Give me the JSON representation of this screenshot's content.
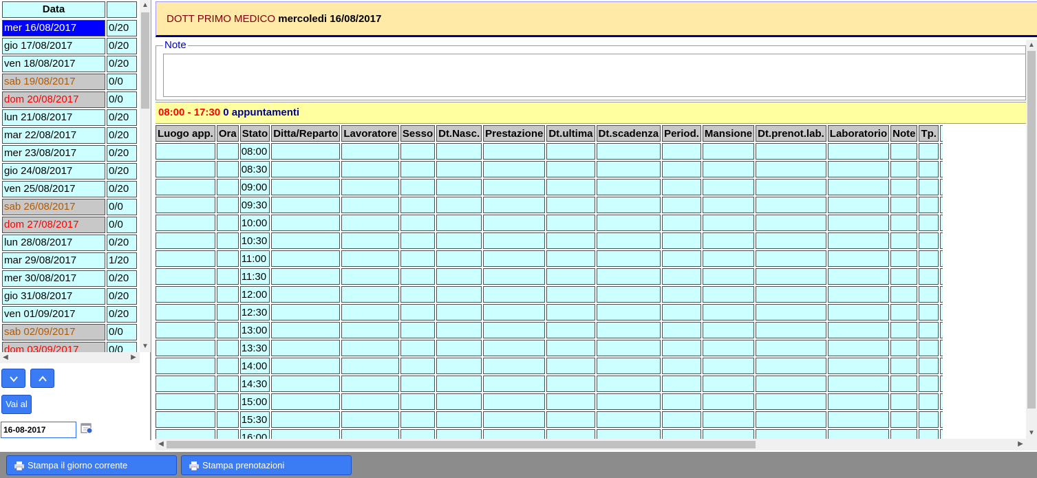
{
  "date_list": {
    "header_date": "Data",
    "header_count": "",
    "rows": [
      {
        "date": "mer 16/08/2017",
        "count": "0/20",
        "kind": "sel"
      },
      {
        "date": "gio 17/08/2017",
        "count": "0/20",
        "kind": "normal"
      },
      {
        "date": "ven 18/08/2017",
        "count": "0/20",
        "kind": "normal"
      },
      {
        "date": "sab 19/08/2017",
        "count": "0/0",
        "kind": "sat"
      },
      {
        "date": "dom 20/08/2017",
        "count": "0/0",
        "kind": "sun"
      },
      {
        "date": "lun 21/08/2017",
        "count": "0/20",
        "kind": "normal"
      },
      {
        "date": "mar 22/08/2017",
        "count": "0/20",
        "kind": "normal"
      },
      {
        "date": "mer 23/08/2017",
        "count": "0/20",
        "kind": "normal"
      },
      {
        "date": "gio 24/08/2017",
        "count": "0/20",
        "kind": "normal"
      },
      {
        "date": "ven 25/08/2017",
        "count": "0/20",
        "kind": "normal"
      },
      {
        "date": "sab 26/08/2017",
        "count": "0/0",
        "kind": "sat"
      },
      {
        "date": "dom 27/08/2017",
        "count": "0/0",
        "kind": "sun"
      },
      {
        "date": "lun 28/08/2017",
        "count": "0/20",
        "kind": "normal"
      },
      {
        "date": "mar 29/08/2017",
        "count": "1/20",
        "kind": "normal"
      },
      {
        "date": "mer 30/08/2017",
        "count": "0/20",
        "kind": "normal"
      },
      {
        "date": "gio 31/08/2017",
        "count": "0/20",
        "kind": "normal"
      },
      {
        "date": "ven 01/09/2017",
        "count": "0/20",
        "kind": "normal"
      },
      {
        "date": "sab 02/09/2017",
        "count": "0/0",
        "kind": "sat"
      },
      {
        "date": "dom 03/09/2017",
        "count": "0/0",
        "kind": "sun"
      }
    ]
  },
  "nav": {
    "down_label": "v",
    "up_label": "^",
    "goto_label": "Vai al",
    "date_value": "16-08-2017"
  },
  "header": {
    "doctor": "DOTT PRIMO MEDICO",
    "date": "mercoledi 16/08/2017"
  },
  "notes": {
    "legend": "Note",
    "value": ""
  },
  "appointments": {
    "hours": "08:00 - 17:30",
    "count_text": "0 appuntamenti"
  },
  "schedule": {
    "columns": [
      "Luogo app.",
      "Ora",
      "Stato",
      "Ditta/Reparto",
      "Lavoratore",
      "Sesso",
      "Dt.Nasc.",
      "Prestazione",
      "Dt.ultima",
      "Dt.scadenza",
      "Period.",
      "Mansione",
      "Dt.prenot.lab.",
      "Laboratorio",
      "Note",
      "Tp."
    ],
    "times": [
      "08:00",
      "08:30",
      "09:00",
      "09:30",
      "10:00",
      "10:30",
      "11:00",
      "11:30",
      "12:00",
      "12:30",
      "13:00",
      "13:30",
      "14:00",
      "14:30",
      "15:00",
      "15:30",
      "16:00"
    ]
  },
  "footer": {
    "print_day": "Stampa il giorno corrente",
    "print_bookings": "Stampa prenotazioni"
  },
  "colors": {
    "cell_bg": "#ccffff",
    "selected": "#0000ff",
    "saturday_text": "#b35900",
    "sunday_text": "#ff0000",
    "title_bg": "#ffeaa8",
    "button": "#3b7cf5"
  }
}
